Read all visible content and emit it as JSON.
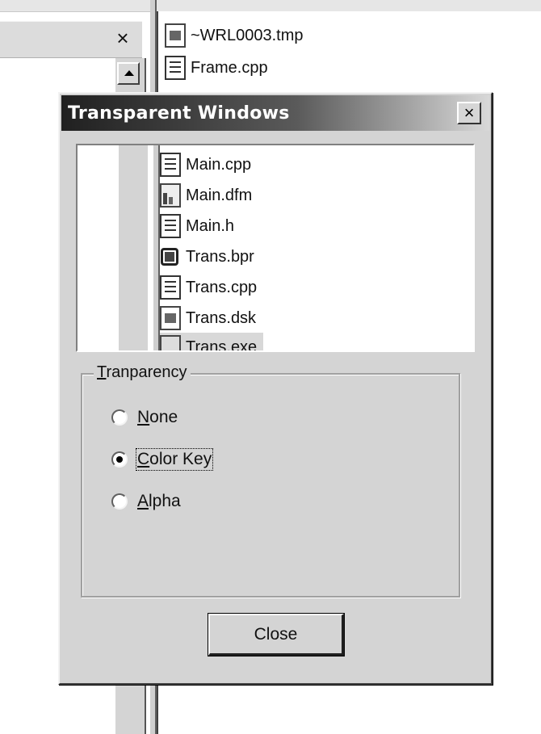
{
  "background": {
    "close_glyph": "×",
    "files": [
      {
        "name": "~WRL0003.tmp",
        "icon": "image-file-icon"
      },
      {
        "name": "Frame.cpp",
        "icon": "document-icon"
      }
    ]
  },
  "dialog": {
    "title": "Transparent Windows",
    "close_glyph": "×",
    "preview_files": [
      {
        "name": "Main.cpp",
        "icon": "document-icon"
      },
      {
        "name": "Main.dfm",
        "icon": "form-file-icon"
      },
      {
        "name": "Main.h",
        "icon": "document-icon"
      },
      {
        "name": "Trans.bpr",
        "icon": "project-icon"
      },
      {
        "name": "Trans.cpp",
        "icon": "document-icon"
      },
      {
        "name": "Trans.dsk",
        "icon": "image-file-icon"
      },
      {
        "name": "Trans.exe",
        "icon": "executable-icon"
      }
    ],
    "group": {
      "legend_underline": "T",
      "legend_rest": "ranparency",
      "options": [
        {
          "underline": "N",
          "rest": "one",
          "checked": false
        },
        {
          "underline": "C",
          "rest": "olor Key",
          "checked": true
        },
        {
          "underline": "A",
          "rest": "lpha",
          "checked": false
        }
      ]
    },
    "close_button": "Close"
  }
}
